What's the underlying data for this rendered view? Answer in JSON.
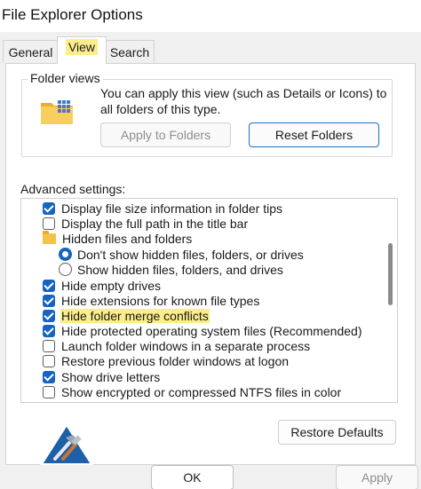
{
  "window": {
    "title": "File Explorer Options"
  },
  "tabs": [
    {
      "label": "General",
      "active": false
    },
    {
      "label": "View",
      "active": true
    },
    {
      "label": "Search",
      "active": false
    }
  ],
  "folder_views": {
    "label": "Folder views",
    "description": "You can apply this view (such as Details or Icons) to all folders of this type.",
    "icon": "folder-grid-icon",
    "apply_button": "Apply to Folders",
    "reset_button": "Reset Folders"
  },
  "advanced": {
    "label": "Advanced settings:",
    "items": [
      {
        "type": "checkbox",
        "checked": true,
        "label": "Display file size information in folder tips"
      },
      {
        "type": "checkbox",
        "checked": false,
        "label": "Display the full path in the title bar"
      },
      {
        "type": "folder",
        "label": "Hidden files and folders"
      },
      {
        "type": "radio",
        "checked": true,
        "label": "Don't show hidden files, folders, or drives"
      },
      {
        "type": "radio",
        "checked": false,
        "label": "Show hidden files, folders, and drives"
      },
      {
        "type": "checkbox",
        "checked": true,
        "label": "Hide empty drives"
      },
      {
        "type": "checkbox",
        "checked": true,
        "label": "Hide extensions for known file types"
      },
      {
        "type": "checkbox",
        "checked": true,
        "label": "Hide folder merge conflicts",
        "highlighted": true
      },
      {
        "type": "checkbox",
        "checked": true,
        "label": "Hide protected operating system files (Recommended)"
      },
      {
        "type": "checkbox",
        "checked": false,
        "label": "Launch folder windows in a separate process"
      },
      {
        "type": "checkbox",
        "checked": false,
        "label": "Restore previous folder windows at logon"
      },
      {
        "type": "checkbox",
        "checked": true,
        "label": "Show drive letters"
      },
      {
        "type": "checkbox",
        "checked": false,
        "label": "Show encrypted or compressed NTFS files in color"
      }
    ],
    "restore_button": "Restore Defaults"
  },
  "footer": {
    "ok": "OK",
    "apply": "Apply"
  },
  "colors": {
    "accent": "#1663c0",
    "highlight": "#fbee8a",
    "folder": "#f4c34a"
  }
}
